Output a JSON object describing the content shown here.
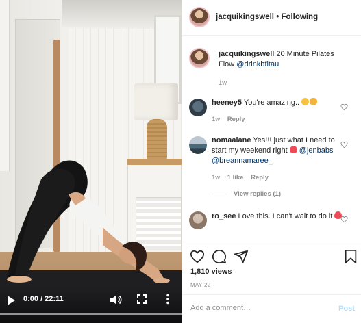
{
  "video": {
    "time": "0:00 / 22:11",
    "progress": 0,
    "icons": [
      "play-icon",
      "volume-icon",
      "fullscreen-icon",
      "more-options-icon"
    ]
  },
  "header": {
    "username": "jacquikingswell",
    "separator": "•",
    "follow_state": "Following"
  },
  "caption": {
    "username": "jacquikingswell",
    "text": "20 Minute Pilates Flow",
    "mention": "@drinkbfitau",
    "age": "1w"
  },
  "comments": [
    {
      "username": "heeney5",
      "text": "You're amazing..",
      "emoji": [
        "hugging-face-emoji",
        "clapping-hands-emoji"
      ],
      "age": "1w",
      "reply_label": "Reply"
    },
    {
      "username": "nomaalane",
      "text": "Yes!!! just what I need to start my weekend right",
      "emoji": [
        "red-heart-emoji"
      ],
      "mentions": [
        "@jenbabs",
        "@breannamaree_"
      ],
      "age": "1w",
      "likes": "1 like",
      "reply_label": "Reply",
      "view_replies": "View replies (1)"
    },
    {
      "username": "ro_see",
      "text": "Love this. I can't wait to do it",
      "emoji": [
        "red-heart-emoji"
      ]
    }
  ],
  "actions": {
    "icons": [
      "like-heart-icon",
      "comment-icon",
      "share-icon",
      "save-bookmark-icon"
    ],
    "views": "1,810 views",
    "date": "MAY 22"
  },
  "add_comment": {
    "placeholder": "Add a comment…",
    "post_label": "Post"
  },
  "colors": {
    "link": "#00376b",
    "muted": "#8e8e8e",
    "post_disabled": "#b2dffc",
    "heart_red": "#ed4956"
  }
}
